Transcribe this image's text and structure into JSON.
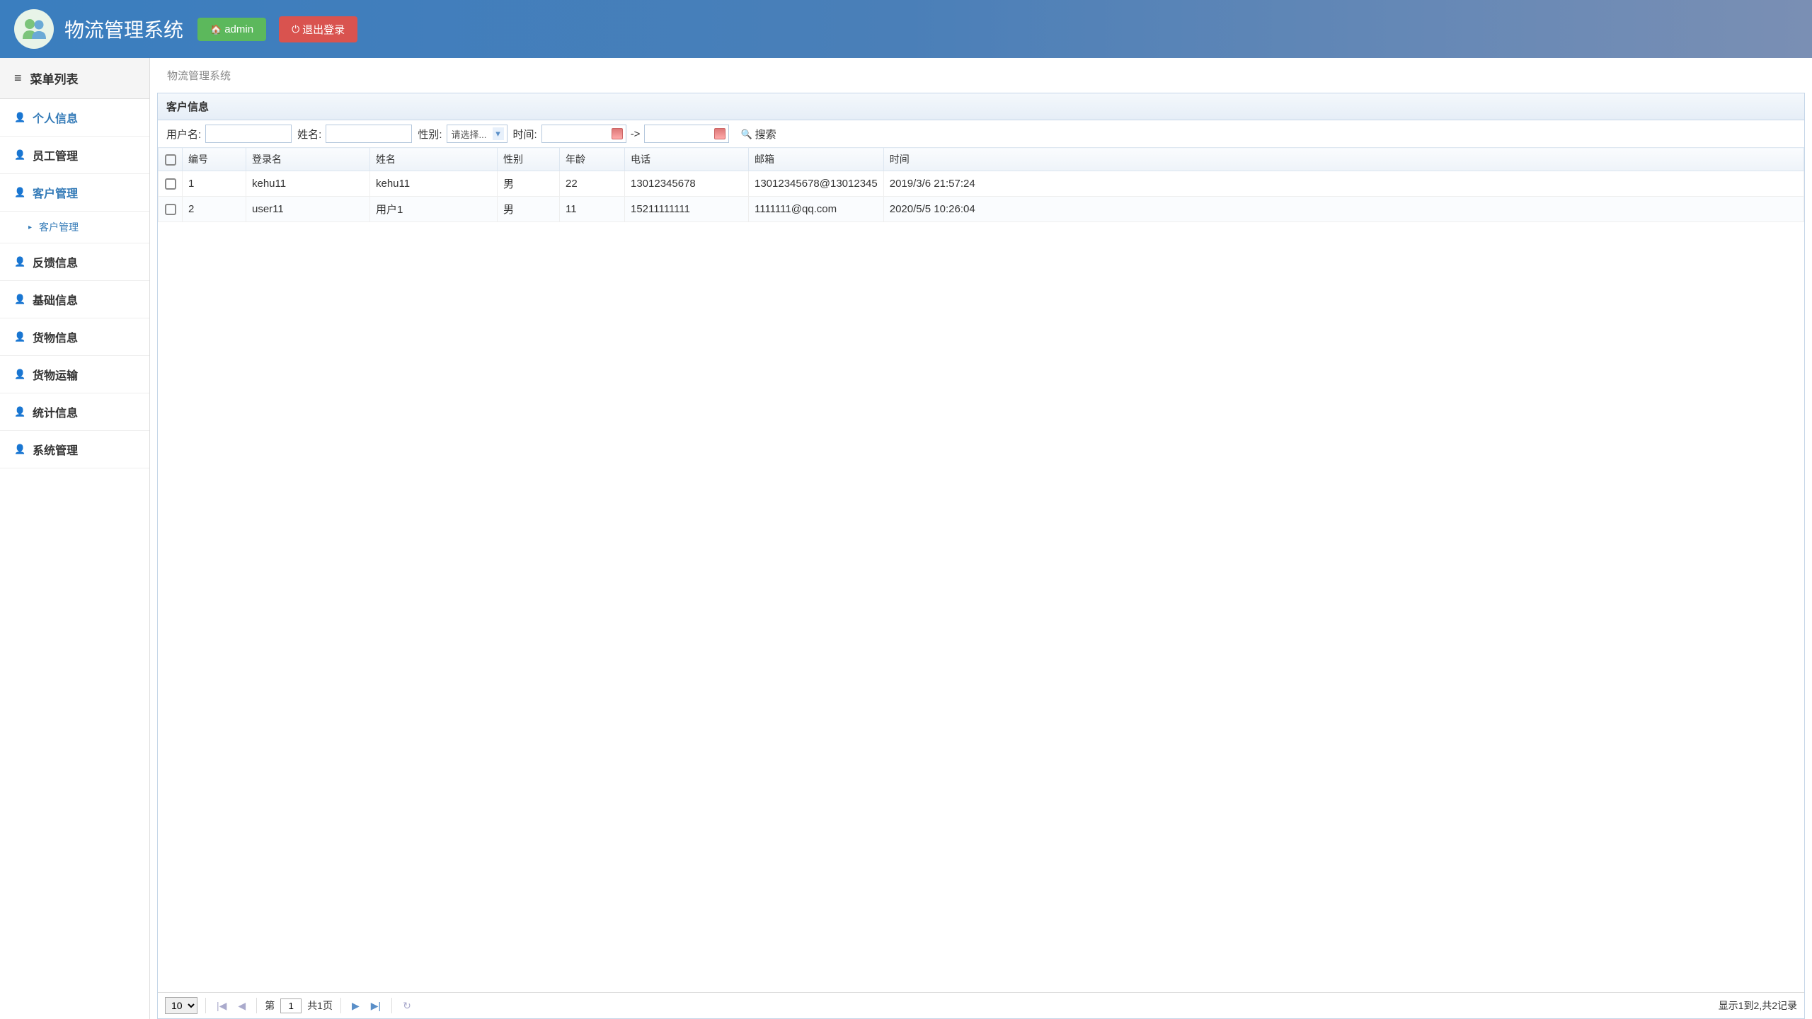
{
  "header": {
    "app_title": "物流管理系统",
    "admin_label": "admin",
    "logout_label": "退出登录"
  },
  "sidebar": {
    "title": "菜单列表",
    "items": [
      {
        "label": "个人信息",
        "active": true
      },
      {
        "label": "员工管理",
        "active": false
      },
      {
        "label": "客户管理",
        "active": true,
        "sub": [
          {
            "label": "客户管理"
          }
        ]
      },
      {
        "label": "反馈信息",
        "active": false
      },
      {
        "label": "基础信息",
        "active": false
      },
      {
        "label": "货物信息",
        "active": false
      },
      {
        "label": "货物运输",
        "active": false
      },
      {
        "label": "统计信息",
        "active": false
      },
      {
        "label": "系统管理",
        "active": false
      }
    ]
  },
  "breadcrumb": "物流管理系统",
  "panel": {
    "title": "客户信息",
    "filters": {
      "username_label": "用户名:",
      "name_label": "姓名:",
      "gender_label": "性别:",
      "gender_placeholder": "请选择...",
      "time_label": "时间:",
      "range_sep": "->",
      "search_label": "搜索"
    },
    "columns": [
      "编号",
      "登录名",
      "姓名",
      "性别",
      "年龄",
      "电话",
      "邮箱",
      "时间"
    ],
    "rows": [
      {
        "num": "1",
        "login": "kehu11",
        "name": "kehu11",
        "gender": "男",
        "age": "22",
        "phone": "13012345678",
        "email": "13012345678@13012345",
        "time": "2019/3/6 21:57:24"
      },
      {
        "num": "2",
        "login": "user11",
        "name": "用户1",
        "gender": "男",
        "age": "11",
        "phone": "15211111111",
        "email": "1111111@qq.com",
        "time": "2020/5/5 10:26:04"
      }
    ]
  },
  "pager": {
    "page_size": "10",
    "page_prefix": "第",
    "page_value": "1",
    "page_total": "共1页",
    "summary": "显示1到2,共2记录"
  }
}
